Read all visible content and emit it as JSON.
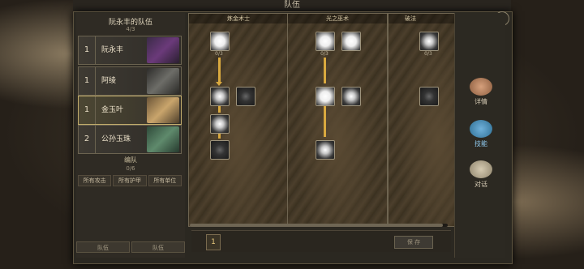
{
  "window": {
    "title": "队伍",
    "close_glyph": "✕"
  },
  "team": {
    "title": "阮永丰的队伍",
    "count": "4/3",
    "members": [
      {
        "level": "1",
        "name": "阮永丰",
        "selected": false
      },
      {
        "level": "1",
        "name": "阿绫",
        "selected": false
      },
      {
        "level": "1",
        "name": "金玉叶",
        "selected": true
      },
      {
        "level": "2",
        "name": "公孙玉珠",
        "selected": false
      }
    ]
  },
  "edit": {
    "title": "编队",
    "count": "0/6",
    "filters": [
      "所有攻击",
      "所有护甲",
      "所有单位"
    ]
  },
  "bottom_tabs": [
    "队伍",
    "队伍"
  ],
  "skill_trees": [
    {
      "title": "炼金术士",
      "counts": [
        "0/3"
      ]
    },
    {
      "title": "光之巫术",
      "counts": [
        "0/3"
      ]
    },
    {
      "title": "破法",
      "counts": [
        "0/3"
      ]
    }
  ],
  "footer": {
    "points": "1",
    "save_label": "保 存"
  },
  "right_tabs": [
    {
      "label": "详情",
      "icon": "flexed-arm-icon"
    },
    {
      "label": "技能",
      "icon": "crystal-book-icon"
    },
    {
      "label": "对话",
      "icon": "speech-bubble-icon"
    }
  ]
}
